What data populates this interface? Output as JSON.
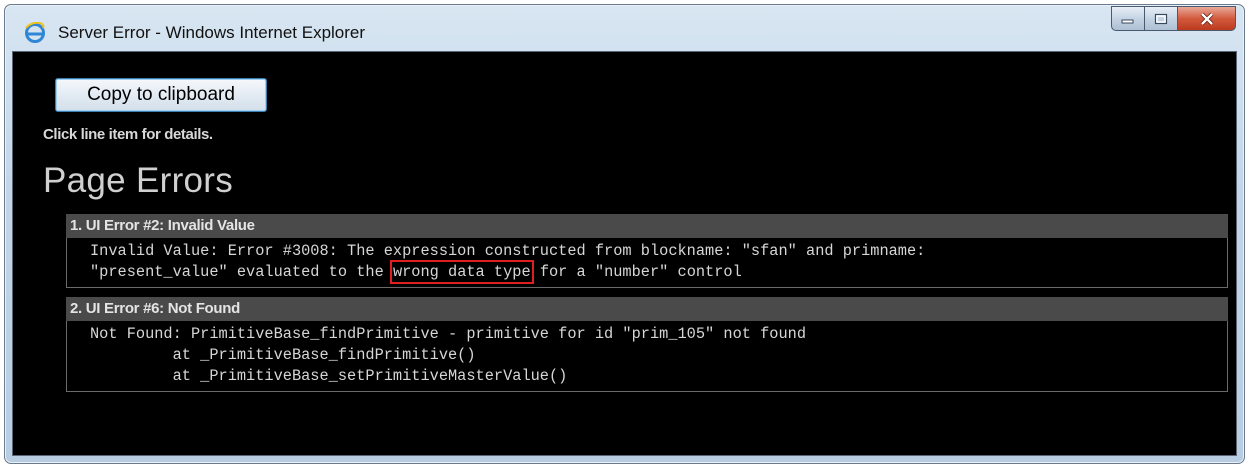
{
  "window": {
    "title": "Server Error - Windows Internet Explorer",
    "app_icon": "internet-explorer-icon",
    "controls": {
      "minimize_icon": "minimize-icon",
      "maximize_icon": "maximize-icon",
      "close_icon": "close-icon"
    },
    "colors": {
      "titlebar": "#c3d6e8",
      "close_button": "#d35a3e",
      "client_background": "#000000"
    }
  },
  "toolbar": {
    "copy_label": "Copy to clipboard",
    "hint": "Click line item for details."
  },
  "page": {
    "title": "Page Errors"
  },
  "errors": [
    {
      "header": "1. UI Error #2: Invalid Value",
      "line1": "Invalid Value: Error #3008: The expression constructed from blockname: \"sfan\" and primname:",
      "line2_before": "\"present_value\" evaluated to the ",
      "line2_highlight": "wrong data type",
      "line2_after": " for a \"number\" control"
    },
    {
      "header": "2. UI Error #6: Not Found",
      "line1": "Not Found: PrimitiveBase_findPrimitive - primitive for id \"prim_105\" not found",
      "line2": "         at _PrimitiveBase_findPrimitive()",
      "line3": "         at _PrimitiveBase_setPrimitiveMasterValue()"
    }
  ],
  "colors": {
    "highlight_box": "#e01e1e",
    "error_header_bg": "#4a4a4a"
  }
}
